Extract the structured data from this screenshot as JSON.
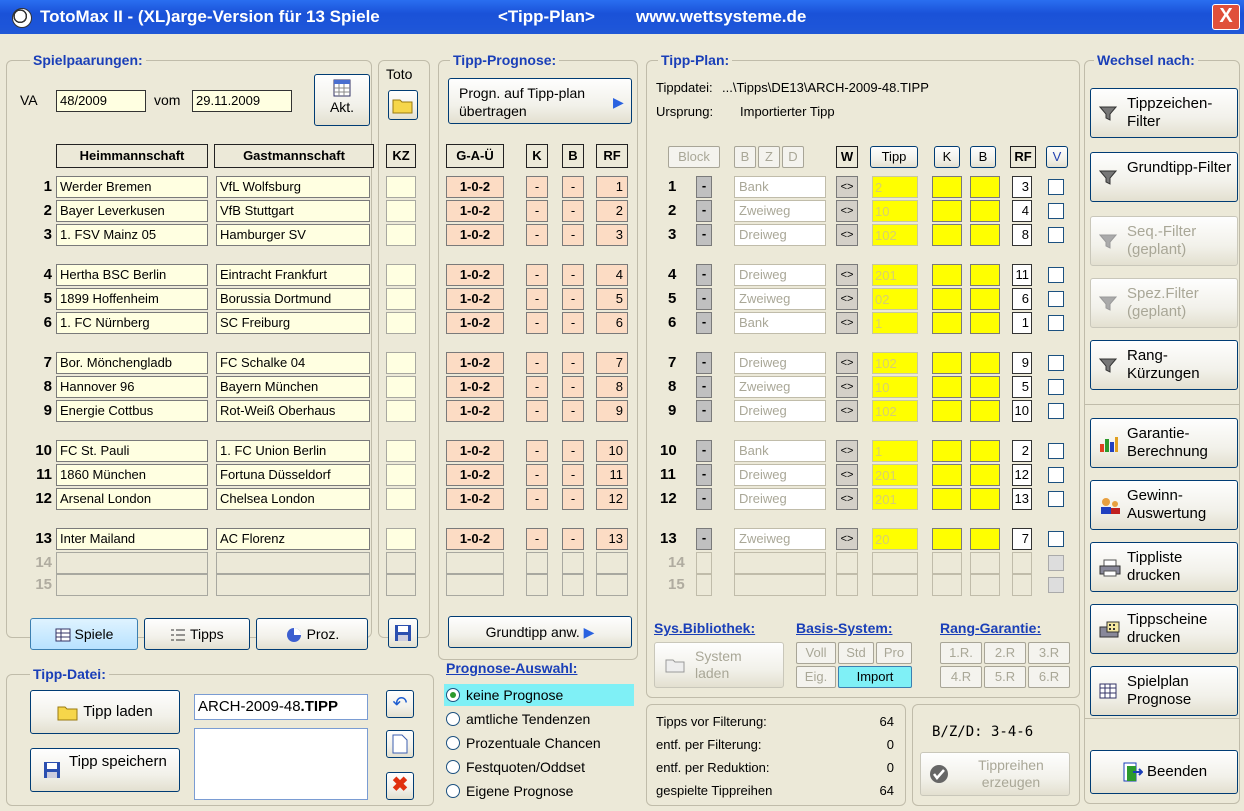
{
  "window": {
    "title_main": "TotoMax II - (XL)arge-Version für 13 Spiele",
    "title_plan": "<Tipp-Plan>",
    "title_url": "www.wettsysteme.de",
    "close": "X"
  },
  "spiele": {
    "title": "Spielpaarungen:",
    "va_label": "VA",
    "va_value": "48/2009",
    "vom_label": "vom",
    "date_value": "29.11.2009",
    "akt_label": "Akt.",
    "head_home": "Heimmannschaft",
    "head_away": "Gastmannschaft",
    "toto_label": "Toto",
    "kz_label": "KZ",
    "rows": [
      {
        "n": "1",
        "home": "Werder Bremen",
        "away": "VfL Wolfsburg"
      },
      {
        "n": "2",
        "home": "Bayer Leverkusen",
        "away": "VfB Stuttgart"
      },
      {
        "n": "3",
        "home": "1. FSV Mainz 05",
        "away": "Hamburger SV"
      },
      {
        "n": "4",
        "home": "Hertha BSC Berlin",
        "away": "Eintracht Frankfurt"
      },
      {
        "n": "5",
        "home": "1899 Hoffenheim",
        "away": "Borussia Dortmund"
      },
      {
        "n": "6",
        "home": "1. FC Nürnberg",
        "away": "SC Freiburg"
      },
      {
        "n": "7",
        "home": "Bor. Mönchengladb",
        "away": "FC Schalke 04"
      },
      {
        "n": "8",
        "home": "Hannover 96",
        "away": "Bayern München"
      },
      {
        "n": "9",
        "home": "Energie Cottbus",
        "away": "Rot-Weiß Oberhaus"
      },
      {
        "n": "10",
        "home": "FC St. Pauli",
        "away": "1. FC Union Berlin"
      },
      {
        "n": "11",
        "home": "1860 München",
        "away": "Fortuna Düsseldorf"
      },
      {
        "n": "12",
        "home": "Arsenal London",
        "away": "Chelsea London"
      },
      {
        "n": "13",
        "home": "Inter Mailand",
        "away": "AC Florenz"
      }
    ],
    "extra_rows": [
      "14",
      "15"
    ],
    "btn_spiele": "Spiele",
    "btn_tipps": "Tipps",
    "btn_proz": "Proz."
  },
  "prognose": {
    "title": "Tipp-Prognose:",
    "btn_uebertragen": "Progn. auf Tipp-plan übertragen",
    "head_gau": "G-A-Ü",
    "head_k": "K",
    "head_b": "B",
    "head_rf": "RF",
    "rows": [
      {
        "g": "1-0-2",
        "k": "-",
        "b": "-",
        "rf": "1"
      },
      {
        "g": "1-0-2",
        "k": "-",
        "b": "-",
        "rf": "2"
      },
      {
        "g": "1-0-2",
        "k": "-",
        "b": "-",
        "rf": "3"
      },
      {
        "g": "1-0-2",
        "k": "-",
        "b": "-",
        "rf": "4"
      },
      {
        "g": "1-0-2",
        "k": "-",
        "b": "-",
        "rf": "5"
      },
      {
        "g": "1-0-2",
        "k": "-",
        "b": "-",
        "rf": "6"
      },
      {
        "g": "1-0-2",
        "k": "-",
        "b": "-",
        "rf": "7"
      },
      {
        "g": "1-0-2",
        "k": "-",
        "b": "-",
        "rf": "8"
      },
      {
        "g": "1-0-2",
        "k": "-",
        "b": "-",
        "rf": "9"
      },
      {
        "g": "1-0-2",
        "k": "-",
        "b": "-",
        "rf": "10"
      },
      {
        "g": "1-0-2",
        "k": "-",
        "b": "-",
        "rf": "11"
      },
      {
        "g": "1-0-2",
        "k": "-",
        "b": "-",
        "rf": "12"
      },
      {
        "g": "1-0-2",
        "k": "-",
        "b": "-",
        "rf": "13"
      }
    ],
    "btn_grundtipp": "Grundtipp anw.",
    "auswahl_title": "Prognose-Auswahl:",
    "options": [
      "keine Prognose",
      "amtliche Tendenzen",
      "Prozentuale Chancen",
      "Festquoten/Oddset",
      "Eigene Prognose"
    ],
    "selected": 0
  },
  "plan": {
    "title": "Tipp-Plan:",
    "tippdatei_label": "Tippdatei:",
    "tippdatei_value": "...\\Tipps\\DE13\\ARCH-2009-48.TIPP",
    "ursprung_label": "Ursprung:",
    "ursprung_value": "Importierter Tipp",
    "head_block": "Block",
    "head_b": "B",
    "head_z": "Z",
    "head_d": "D",
    "head_w": "W",
    "head_tipp": "Tipp",
    "head_k": "K",
    "head_bb": "B",
    "head_rf": "RF",
    "head_v": "V",
    "rows": [
      {
        "n": "1",
        "type": "Bank",
        "tipp": "2",
        "rf": "3"
      },
      {
        "n": "2",
        "type": "Zweiweg",
        "tipp": "10",
        "rf": "4"
      },
      {
        "n": "3",
        "type": "Dreiweg",
        "tipp": "102",
        "rf": "8"
      },
      {
        "n": "4",
        "type": "Dreiweg",
        "tipp": "201",
        "rf": "11"
      },
      {
        "n": "5",
        "type": "Zweiweg",
        "tipp": "02",
        "rf": "6"
      },
      {
        "n": "6",
        "type": "Bank",
        "tipp": "1",
        "rf": "1"
      },
      {
        "n": "7",
        "type": "Dreiweg",
        "tipp": "102",
        "rf": "9"
      },
      {
        "n": "8",
        "type": "Zweiweg",
        "tipp": "10",
        "rf": "5"
      },
      {
        "n": "9",
        "type": "Dreiweg",
        "tipp": "102",
        "rf": "10"
      },
      {
        "n": "10",
        "type": "Bank",
        "tipp": "1",
        "rf": "2"
      },
      {
        "n": "11",
        "type": "Dreiweg",
        "tipp": "201",
        "rf": "12"
      },
      {
        "n": "12",
        "type": "Dreiweg",
        "tipp": "201",
        "rf": "13"
      },
      {
        "n": "13",
        "type": "Zweiweg",
        "tipp": "20",
        "rf": "7"
      }
    ],
    "extra_rows": [
      "14",
      "15"
    ],
    "block_sym": "-",
    "arrow_sym": "<>",
    "sysbib": "Sys.Bibliothek:",
    "basis": "Basis-System:",
    "rang": "Rang-Garantie:",
    "btn_system": "System laden",
    "basis_btns": [
      "Voll",
      "Std",
      "Pro",
      "Eig.",
      "Import"
    ],
    "rang_btns": [
      "1.R.",
      "2.R",
      "3.R",
      "4.R",
      "5.R",
      "6.R"
    ],
    "stats": [
      {
        "label": "Tipps vor Filterung:",
        "value": "64"
      },
      {
        "label": "entf. per Filterung:",
        "value": "0"
      },
      {
        "label": "entf. per Reduktion:",
        "value": "0"
      },
      {
        "label": "gespielte Tippreihen",
        "value": "64"
      }
    ],
    "bzd": "B/Z/D:  3-4-6",
    "btn_erzeugen": "Tippreihen erzeugen"
  },
  "datei": {
    "title": "Tipp-Datei:",
    "btn_laden": "Tipp laden",
    "btn_speichern": "Tipp speichern",
    "filename": "ARCH-2009-48",
    "ext": ".TIPP"
  },
  "wechsel": {
    "title": "Wechsel nach:",
    "buttons": [
      {
        "label": "Tippzeichen-Filter",
        "enabled": true,
        "icon": "filter-icon"
      },
      {
        "label": "Grundtipp-Filter",
        "enabled": true,
        "icon": "filter-icon"
      },
      {
        "label": "Seq.-Filter (geplant)",
        "enabled": false,
        "icon": "filter-icon"
      },
      {
        "label": "Spez.Filter (geplant)",
        "enabled": false,
        "icon": "filter-icon"
      },
      {
        "label": "Rang-Kürzungen",
        "enabled": true,
        "icon": "filter-icon"
      },
      {
        "label": "Garantie-Berechnung",
        "enabled": true,
        "icon": "chart-icon"
      },
      {
        "label": "Gewinn-Auswertung",
        "enabled": true,
        "icon": "people-icon"
      },
      {
        "label": "Tippliste drucken",
        "enabled": true,
        "icon": "printer-icon"
      },
      {
        "label": "Tippscheine drucken",
        "enabled": true,
        "icon": "printer-calc-icon"
      },
      {
        "label": "Spielplan Prognose",
        "enabled": true,
        "icon": "table-icon"
      }
    ],
    "btn_beenden": "Beenden"
  },
  "colors": {
    "title_blue": "#1a3fb8",
    "cell_yellow": "#ffffe1",
    "tipp_yellow": "#ffff00",
    "prog_peach": "#fcdcc4",
    "selected_cyan": "#7ff0f6"
  }
}
